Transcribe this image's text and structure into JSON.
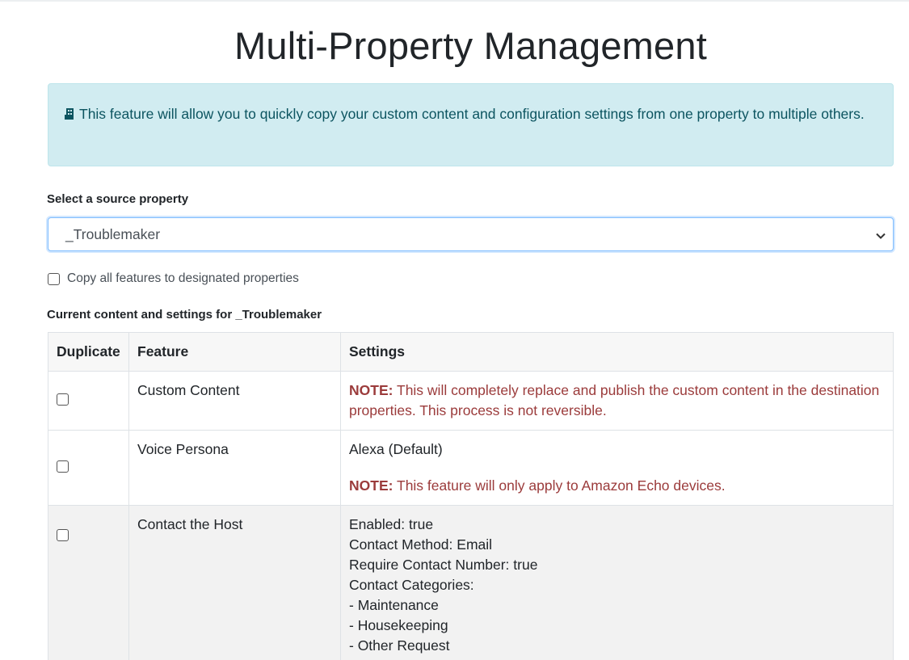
{
  "page": {
    "title": "Multi-Property Management"
  },
  "info": {
    "icon": "building-icon",
    "text": "This feature will allow you to quickly copy your custom content and configuration settings from one property to multiple others."
  },
  "source_select": {
    "label": "Select a source property",
    "value": "_Troublemaker"
  },
  "copy_all": {
    "label": "Copy all features to designated properties",
    "checked": false
  },
  "current_label": "Current content and settings for _Troublemaker",
  "table": {
    "headers": [
      "Duplicate",
      "Feature",
      "Settings"
    ],
    "rows": [
      {
        "feature": "Custom Content",
        "note_prefix": "NOTE:",
        "note_text": "This will completely replace and publish the custom content in the destination properties. This process is not reversible."
      },
      {
        "feature": "Voice Persona",
        "setting": "Alexa (Default)",
        "note_prefix": "NOTE:",
        "note_text": "This feature will only apply to Amazon Echo devices."
      },
      {
        "feature": "Contact the Host",
        "lines": [
          "Enabled: true",
          "Contact Method: Email",
          "Require Contact Number: true",
          "Contact Categories:",
          "- Maintenance",
          "- Housekeeping",
          "- Other Request"
        ]
      }
    ]
  },
  "colors": {
    "info_bg": "#d1ecf1",
    "info_text": "#0c5460",
    "note_text": "#9b3b3b",
    "focus_border": "#80bdff"
  }
}
